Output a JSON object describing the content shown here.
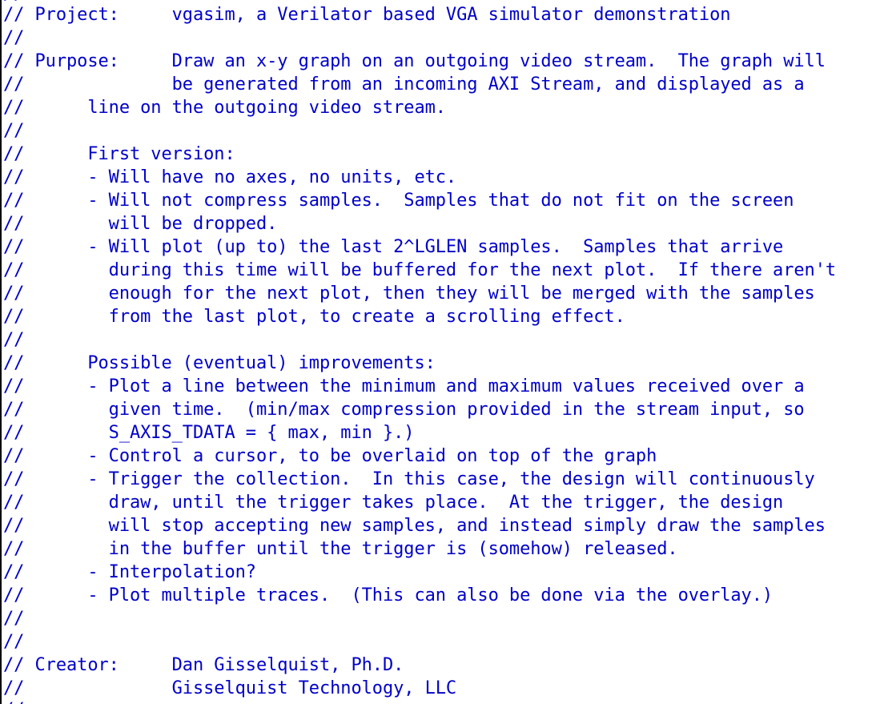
{
  "editor": {
    "comment_color": "#0000c8",
    "top_partial": "//",
    "bottom_partial": "//",
    "lines": [
      "// Project:     vgasim, a Verilator based VGA simulator demonstration",
      "//",
      "// Purpose:     Draw an x-y graph on an outgoing video stream.  The graph will",
      "//              be generated from an incoming AXI Stream, and displayed as a",
      "//      line on the outgoing video stream.",
      "//",
      "//      First version:",
      "//      - Will have no axes, no units, etc.",
      "//      - Will not compress samples.  Samples that do not fit on the screen",
      "//        will be dropped.",
      "//      - Will plot (up to) the last 2^LGLEN samples.  Samples that arrive",
      "//        during this time will be buffered for the next plot.  If there aren't",
      "//        enough for the next plot, then they will be merged with the samples",
      "//        from the last plot, to create a scrolling effect.",
      "//",
      "//      Possible (eventual) improvements:",
      "//      - Plot a line between the minimum and maximum values received over a",
      "//        given time.  (min/max compression provided in the stream input, so",
      "//        S_AXIS_TDATA = { max, min }.)",
      "//      - Control a cursor, to be overlaid on top of the graph",
      "//      - Trigger the collection.  In this case, the design will continuously",
      "//        draw, until the trigger takes place.  At the trigger, the design",
      "//        will stop accepting new samples, and instead simply draw the samples",
      "//        in the buffer until the trigger is (somehow) released.",
      "//      - Interpolation?",
      "//      - Plot multiple traces.  (This can also be done via the overlay.)",
      "//",
      "//",
      "// Creator:     Dan Gisselquist, Ph.D.",
      "//              Gisselquist Technology, LLC"
    ]
  }
}
